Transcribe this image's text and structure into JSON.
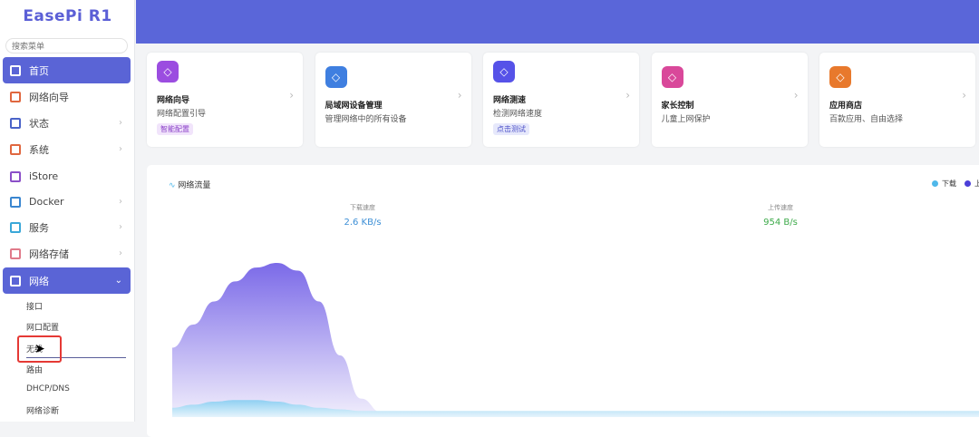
{
  "sidebar": {
    "logo": "EasePi R1",
    "search_placeholder": "搜索菜单",
    "items": [
      {
        "label": "首页",
        "icon": "dashboard-icon",
        "active": true
      },
      {
        "label": "网络向导",
        "icon": "globe-icon"
      },
      {
        "label": "状态",
        "icon": "grid-icon",
        "chevron": "›"
      },
      {
        "label": "系统",
        "icon": "gear-icon",
        "chevron": "›"
      },
      {
        "label": "iStore",
        "icon": "bag-icon"
      },
      {
        "label": "Docker",
        "icon": "docker-icon",
        "chevron": "›"
      },
      {
        "label": "服务",
        "icon": "link-icon",
        "chevron": "›"
      },
      {
        "label": "网络存储",
        "icon": "database-icon",
        "chevron": "›"
      },
      {
        "label": "网络",
        "icon": "network-icon",
        "chevron": "⌄",
        "active": true
      }
    ],
    "subitems": [
      "接口",
      "网口配置",
      "无线",
      "路由",
      "DHCP/DNS",
      "网络诊断"
    ]
  },
  "cards": [
    {
      "title": "网络向导",
      "desc": "网络配置引导",
      "tag": "智能配置",
      "icon": "navigation-icon",
      "color": "#9b4de0"
    },
    {
      "title": "局域网设备管理",
      "desc": "管理网络中的所有设备",
      "icon": "sitemap-icon",
      "color": "#3f7fe0"
    },
    {
      "title": "网络测速",
      "desc": "检测网络速度",
      "tag": "点击测试",
      "icon": "speedometer-icon",
      "color": "#5652e8"
    },
    {
      "title": "家长控制",
      "desc": "儿童上网保护",
      "icon": "baby-icon",
      "color": "#d9489a"
    },
    {
      "title": "应用商店",
      "desc": "百款应用、自由选择",
      "icon": "shopping-bag-icon",
      "color": "#e8792c"
    }
  ],
  "traffic": {
    "title": "网络流量",
    "legend": [
      {
        "label": "下载",
        "color": "#4fb8ea"
      },
      {
        "label": "上传",
        "color": "#4b3fd8"
      }
    ],
    "download_label": "下载速度",
    "download_value": "2.6 KB/s",
    "upload_label": "上传速度",
    "upload_value": "954 B/s"
  },
  "chart_data": {
    "type": "area",
    "series": [
      {
        "name": "上传",
        "values": [
          0.45,
          0.6,
          0.75,
          0.88,
          0.97,
          1.0,
          0.95,
          0.75,
          0.4,
          0.12,
          0.03,
          0.01,
          0,
          0,
          0,
          0,
          0,
          0,
          0,
          0,
          0,
          0,
          0,
          0,
          0,
          0,
          0,
          0,
          0,
          0,
          0,
          0,
          0,
          0,
          0,
          0,
          0,
          0,
          0,
          0
        ]
      },
      {
        "name": "下载",
        "values": [
          0.06,
          0.08,
          0.1,
          0.11,
          0.11,
          0.1,
          0.08,
          0.06,
          0.05,
          0.04,
          0.04,
          0.04,
          0.04,
          0.04,
          0.04,
          0.04,
          0.04,
          0.04,
          0.04,
          0.04,
          0.04,
          0.04,
          0.04,
          0.04,
          0.04,
          0.04,
          0.04,
          0.04,
          0.04,
          0.04,
          0.04,
          0.04,
          0.04,
          0.04,
          0.04,
          0.04,
          0.04,
          0.04,
          0.04,
          0.04
        ]
      }
    ]
  }
}
